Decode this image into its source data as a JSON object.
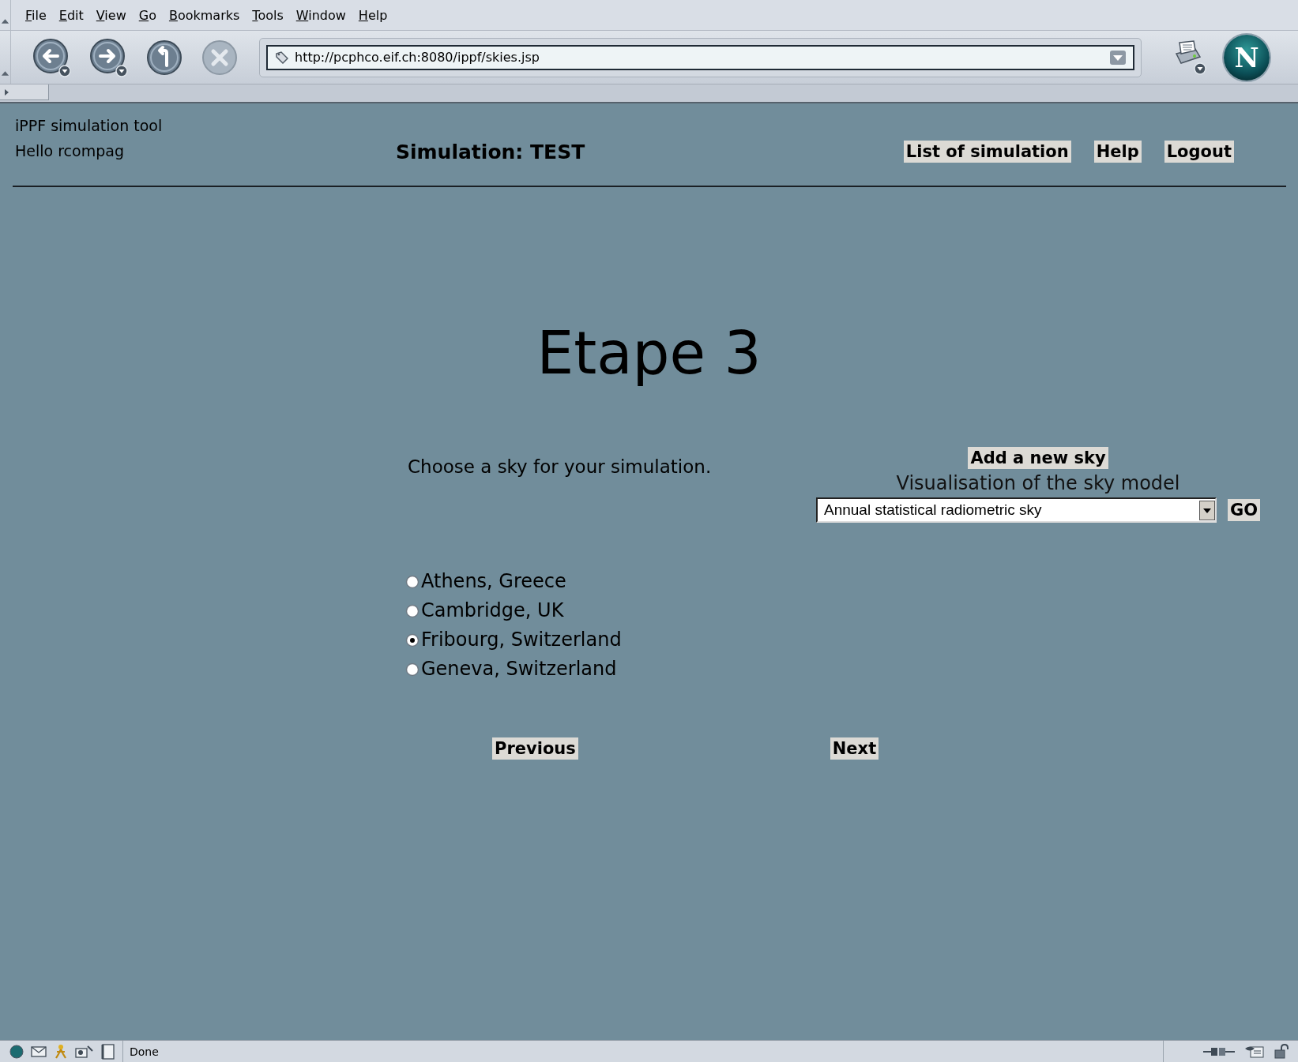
{
  "menu": [
    {
      "label": "File"
    },
    {
      "label": "Edit"
    },
    {
      "label": "View"
    },
    {
      "label": "Go"
    },
    {
      "label": "Bookmarks"
    },
    {
      "label": "Tools"
    },
    {
      "label": "Window"
    },
    {
      "label": "Help"
    }
  ],
  "toolbar": {
    "url": "http://pcphco.eif.ch:8080/ippf/skies.jsp",
    "logo_letter": "N",
    "stop_disabled": true
  },
  "header": {
    "app_title": "iPPF simulation tool",
    "greeting": "Hello rcompag",
    "simulation_title": "Simulation: TEST",
    "nav_buttons": [
      "List of simulation",
      "Help",
      "Logout"
    ]
  },
  "step": {
    "title": "Etape 3",
    "instruction": "Choose a sky for your simulation.",
    "add_sky_button": "Add a new sky",
    "visualisation_label": "Visualisation of the sky model",
    "sky_model_select": {
      "value": "Annual statistical radiometric sky"
    },
    "go_button": "GO",
    "skies": [
      {
        "label": "Athens, Greece",
        "selected": false
      },
      {
        "label": "Cambridge, UK",
        "selected": false
      },
      {
        "label": "Fribourg, Switzerland",
        "selected": true
      },
      {
        "label": "Geneva, Switzerland",
        "selected": false
      }
    ],
    "previous_button": "Previous",
    "next_button": "Next"
  },
  "status_bar": {
    "text": "Done"
  }
}
